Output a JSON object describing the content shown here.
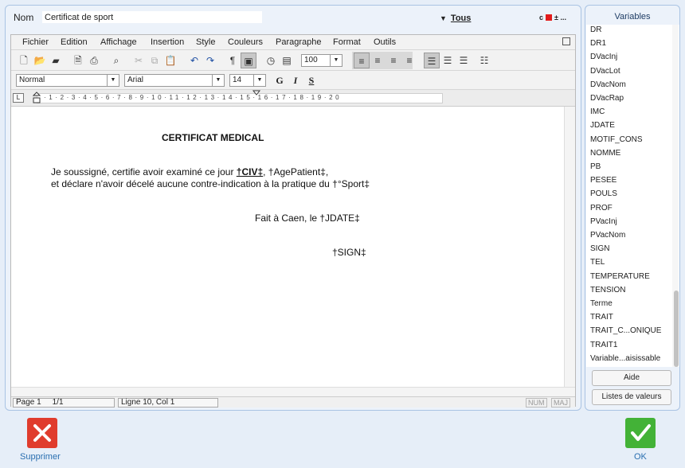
{
  "header": {
    "name_label": "Nom",
    "name_value": "Certificat de sport",
    "filter_label": "Tous",
    "mini_letter": "c",
    "mini_plus": "±",
    "mini_dots": "..."
  },
  "menu": [
    "Fichier",
    "Edition",
    "Affichage",
    "Insertion",
    "Style",
    "Couleurs",
    "Paragraphe",
    "Format",
    "Outils"
  ],
  "toolbar": {
    "zoom": "100",
    "style": "Normal",
    "font": "Arial",
    "size": "14",
    "bold": "G",
    "italic": "I",
    "underline": "S"
  },
  "ruler": "·1·2·3·4·5·6·7·8·9·10·11·12·13·14·15·16·17·18·19·20",
  "document": {
    "title": "CERTIFICAT MEDICAL",
    "line1_before": "Je soussigné, certifie avoir examiné ce jour ",
    "line1_civ": "†CIV‡",
    "line1_after": ", †AgePatient‡,",
    "line2": "et déclare n'avoir décelé aucune contre-indication à la pratique du †°Sport‡",
    "faite": "Fait à Caen, le †JDATE‡",
    "sign": "†SIGN‡"
  },
  "status": {
    "page": "Page 1",
    "pages": "1/1",
    "position": "Ligne 10, Col 1",
    "num": "NUM",
    "maj": "MAJ"
  },
  "variables": {
    "title": "Variables",
    "items": [
      "DR",
      "DR1",
      "DVacInj",
      "DVacLot",
      "DVacNom",
      "DVacRap",
      "IMC",
      "JDATE",
      "MOTIF_CONS",
      "NOMME",
      "PB",
      "PESEE",
      "POULS",
      "PROF",
      "PVacInj",
      "PVacNom",
      "SIGN",
      "TEL",
      "TEMPERATURE",
      "TENSION",
      "Terme",
      "TRAIT",
      "TRAIT_C...ONIQUE",
      "TRAIT1",
      "Variable...aisissable"
    ],
    "help_button": "Aide",
    "values_button": "Listes de valeurs"
  },
  "footer": {
    "delete_label": "Supprimer",
    "ok_label": "OK"
  },
  "colors": {
    "accent_blue": "#2a6fb0",
    "delete_red": "#e03c2d",
    "ok_green": "#43b237"
  }
}
